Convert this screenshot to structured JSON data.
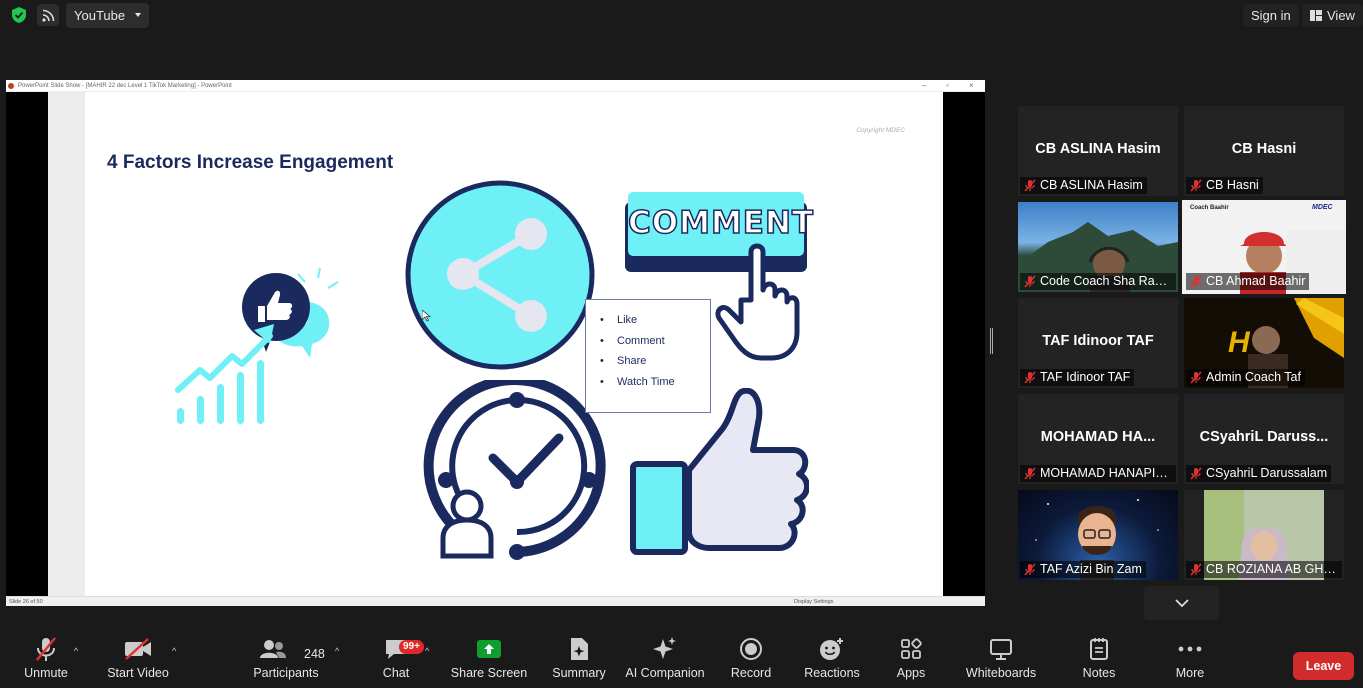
{
  "topbar": {
    "source_label": "YouTube",
    "sign_in": "Sign in",
    "view": "View"
  },
  "share": {
    "window_title": "PowerPoint Slide Show - [MAHIR 22 dec Level 1 TikTok Marketing] - PowerPoint",
    "status_slide": "Slide 26 of 50",
    "status_display": "Display Settings",
    "slide": {
      "title": "4 Factors Increase Engagement",
      "copyright": "Copyright MDEC",
      "comment_banner": "COMMENT",
      "bullets": [
        "Like",
        "Comment",
        "Share",
        "Watch Time"
      ]
    }
  },
  "gallery": {
    "tiles": [
      {
        "big_name": "CB ASLINA Hasim",
        "name": "CB ASLINA Hasim"
      },
      {
        "big_name": "CB Hasni",
        "name": "CB Hasni"
      },
      {
        "big_name": "",
        "name": "Code Coach Sha Ravi..."
      },
      {
        "big_name": "",
        "name": "CB Ahmad Baahir",
        "video_caption": "Coach Baahir",
        "video_logo": "MDEC"
      },
      {
        "big_name": "TAF Idinoor TAF",
        "name": "TAF Idinoor TAF"
      },
      {
        "big_name": "",
        "name": "Admin Coach Taf"
      },
      {
        "big_name": "MOHAMAD  HA...",
        "name": "MOHAMAD HANAPIA..."
      },
      {
        "big_name": "CSyahriL  Daruss...",
        "name": "CSyahriL Darussalam"
      },
      {
        "big_name": "",
        "name": "TAF Azizi Bin Zam"
      },
      {
        "big_name": "",
        "name": "CB ROZIANA AB GHANI"
      }
    ]
  },
  "toolbar": {
    "unmute": "Unmute",
    "start_video": "Start Video",
    "participants": "Participants",
    "participants_count": "248",
    "chat": "Chat",
    "chat_badge": "99+",
    "share_screen": "Share Screen",
    "summary": "Summary",
    "ai_companion": "AI Companion",
    "record": "Record",
    "reactions": "Reactions",
    "apps": "Apps",
    "whiteboards": "Whiteboards",
    "notes": "Notes",
    "more": "More",
    "leave": "Leave"
  },
  "colors": {
    "share_green": "#0e9e2e",
    "leave_red": "#d12b2b",
    "active_speaker": "#6fdc3b",
    "slide_navy": "#1b2a5e",
    "slide_cyan": "#6ff0f7"
  }
}
